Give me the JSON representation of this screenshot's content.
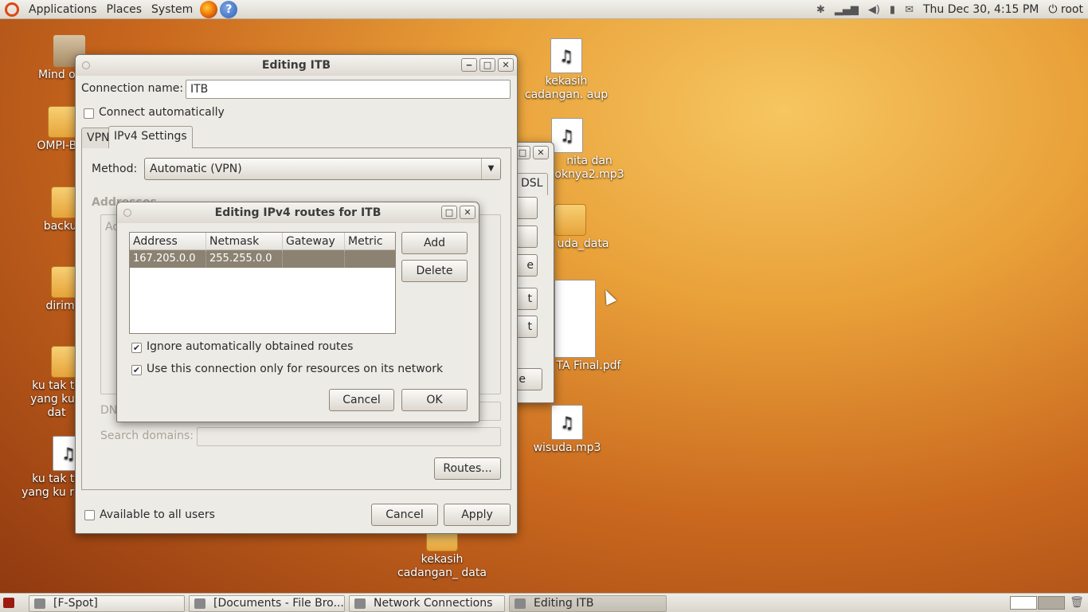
{
  "top_panel": {
    "menus": [
      "Applications",
      "Places",
      "System"
    ],
    "clock": "Thu Dec 30,  4:15 PM",
    "user": "root"
  },
  "desktop_icons": [
    {
      "label": "Mind over I",
      "kind": "zip",
      "badge": "zip"
    },
    {
      "label": "OMPI-Bah",
      "kind": "folder"
    },
    {
      "label": "backup",
      "kind": "folder"
    },
    {
      "label": "dirimu",
      "kind": "folder"
    },
    {
      "label": "ku tak ta yang ku r dat",
      "kind": "folder"
    },
    {
      "label": "ku tak ta yang ku r au",
      "kind": "audio"
    },
    {
      "label": "kekasih cadangan. aup",
      "kind": "audio"
    },
    {
      "label": "nita dan oknya2.mp3",
      "kind": "mp3",
      "badge": "mp3"
    },
    {
      "label": "uda_data",
      "kind": "folder"
    },
    {
      "label": "TA Final.pdf",
      "kind": "pdf"
    },
    {
      "label": "wisuda.mp3",
      "kind": "mp3",
      "badge": "mp3"
    },
    {
      "label": "kekasih cadangan_ data",
      "kind": "folder"
    }
  ],
  "back_window": {
    "tab_label": "DSL",
    "button_fragments": [
      "e",
      "t",
      "t",
      "e"
    ]
  },
  "editing_itb": {
    "title": "Editing ITB",
    "connection_name_label": "Connection name:",
    "connection_name_value": "ITB",
    "connect_automatically": "Connect automatically",
    "tabs": [
      "VPN",
      "IPv4 Settings"
    ],
    "method_label": "Method:",
    "method_value": "Automatic (VPN)",
    "addresses_heading": "Addresses",
    "addresses_col_fragment": "Ad",
    "dns_label_fragment": "DN",
    "search_domains_label": "Search domains:",
    "routes_button": "Routes...",
    "available_all_users": "Available to all users",
    "cancel": "Cancel",
    "apply": "Apply"
  },
  "routes_dialog": {
    "title": "Editing IPv4 routes for ITB",
    "columns": [
      "Address",
      "Netmask",
      "Gateway",
      "Metric"
    ],
    "rows": [
      {
        "address": "167.205.0.0",
        "netmask": "255.255.0.0",
        "gateway": "",
        "metric": ""
      }
    ],
    "add": "Add",
    "delete": "Delete",
    "ignore_routes": "Ignore automatically obtained routes",
    "ignore_routes_checked": true,
    "only_resources": "Use this connection only for resources on its network",
    "only_resources_checked": true,
    "cancel": "Cancel",
    "ok": "OK"
  },
  "taskbar": [
    {
      "label": "[F-Spot]",
      "active": false
    },
    {
      "label": "[Documents - File Bro...",
      "active": false
    },
    {
      "label": "Network Connections",
      "active": false
    },
    {
      "label": "Editing ITB",
      "active": true
    }
  ],
  "colors": {
    "selection": "#8c8272",
    "panel": "#dcd8cf",
    "ubuntu_orange": "#dd4814"
  }
}
